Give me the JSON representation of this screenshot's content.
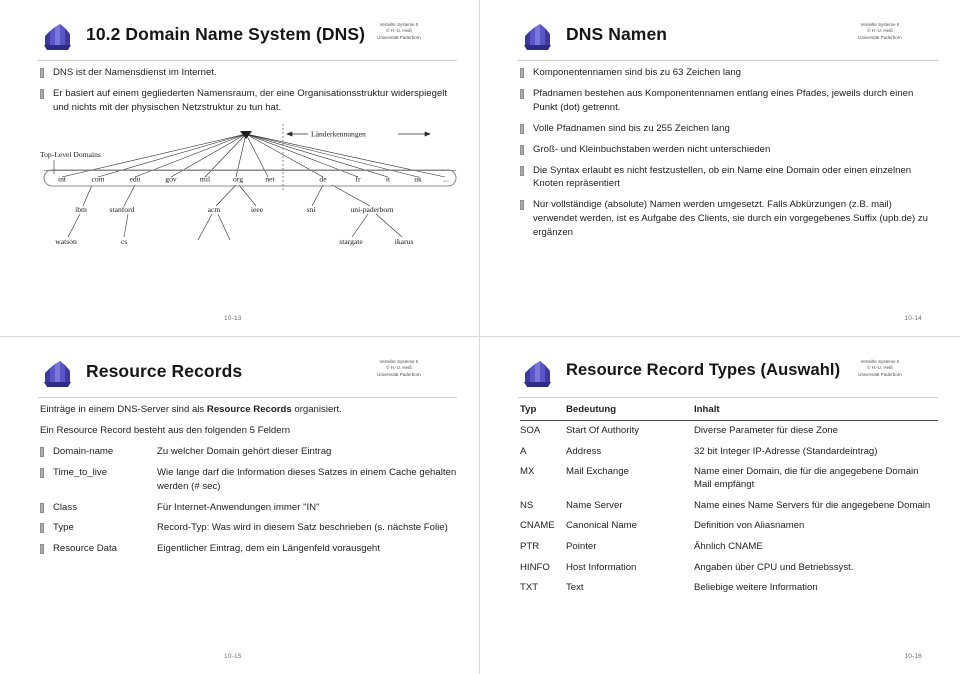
{
  "meta_block": {
    "line1": "Verteilte Systeme II",
    "line2": "© H.-U. Heiß",
    "line3": "Universität Paderborn"
  },
  "slides": [
    {
      "id": "dns-overview",
      "title": "10.2 Domain Name System (DNS)",
      "page": "10-13",
      "bullets": [
        "DNS ist der Namensdienst im Internet.",
        "Er basiert auf einem gegliederten Namensraum, der eine Organisationsstruktur widerspiegelt und nichts mit der physischen Netzstruktur zu tun hat."
      ],
      "diagram": {
        "label_toplevel": "Top-Level Domains",
        "label_country": "Länderkennungen",
        "tlds": [
          "int",
          "com",
          "edu",
          "gov",
          "mil",
          "org",
          "net",
          "de",
          "fr",
          "it",
          "uk",
          "..."
        ],
        "level2": [
          "ibm",
          "stanford",
          "acm",
          "ieee",
          "sni",
          "uni-paderborn"
        ],
        "level3": [
          "watson",
          "cs",
          "stargate",
          "ikarus"
        ]
      }
    },
    {
      "id": "dns-namen",
      "title": "DNS Namen",
      "page": "10-14",
      "bullets": [
        "Komponentennamen sind bis zu 63 Zeichen lang",
        "Pfadnamen bestehen aus Komponentennamen entlang eines Pfades, jeweils durch einen Punkt (dot) getrennt.",
        "Volle Pfadnamen sind bis zu 255 Zeichen lang",
        "Groß- und Kleinbuchstaben werden nicht unterschieden",
        "Die Syntax erlaubt es nicht festzustellen, ob ein Name eine Domain oder einen einzelnen Knoten repräsentiert",
        "Nur vollständige (absolute) Namen werden umgesetzt. Falls Abkürzungen (z.B. mail) verwendet werden, ist es Aufgabe des Clients, sie durch ein vorgegebenes Suffix (upb.de) zu ergänzen"
      ]
    },
    {
      "id": "resource-records",
      "title": "Resource Records",
      "page": "10-15",
      "intro": [
        {
          "pre": "Einträge in einem DNS-Server sind als ",
          "strong": "Resource Records",
          "post": " organisiert."
        },
        {
          "pre": "Ein Resource Record besteht aus den folgenden 5 Feldern",
          "strong": "",
          "post": ""
        }
      ],
      "fields": [
        {
          "name": "Domain-name",
          "desc": "Zu welcher Domain gehört dieser Eintrag"
        },
        {
          "name": "Time_to_live",
          "desc": "Wie lange darf die Information dieses Satzes in einem Cache gehalten werden (# sec)"
        },
        {
          "name": "Class",
          "desc": "Für Internet-Anwendungen immer \"IN\""
        },
        {
          "name": "Type",
          "desc": "Record-Typ: Was wird in diesem Satz beschrieben (s. nächste Folie)"
        },
        {
          "name": "Resource Data",
          "desc": "Eigentlicher Eintrag, dem ein Längenfeld vorausgeht"
        }
      ]
    },
    {
      "id": "rr-types",
      "title": "Resource Record Types (Auswahl)",
      "page": "10-16",
      "table": {
        "headers": [
          "Typ",
          "Bedeutung",
          "Inhalt"
        ],
        "rows": [
          [
            "SOA",
            "Start Of Authority",
            "Diverse Parameter für diese Zone"
          ],
          [
            "A",
            "Address",
            "32 bit Integer IP-Adresse (Standardeintrag)"
          ],
          [
            "MX",
            "Mail Exchange",
            "Name einer Domain, die für die angegebene Domain Mail empfängt"
          ],
          [
            "NS",
            "Name Server",
            "Name eines Name Servers für die angegebene Domain"
          ],
          [
            "CNAME",
            "Canonical Name",
            "Definition von Aliasnamen"
          ],
          [
            "PTR",
            "Pointer",
            "Ähnlich CNAME"
          ],
          [
            "HINFO",
            "Host Information",
            "Angaben über CPU und Betriebssyst."
          ],
          [
            "TXT",
            "Text",
            "Beliebige weitere Information"
          ]
        ]
      }
    }
  ],
  "colors": {
    "logo_blue": "#4a46b4",
    "logo_light": "#8f8ce0",
    "rule": "#cfcfcf",
    "text": "#1f1f1f"
  }
}
